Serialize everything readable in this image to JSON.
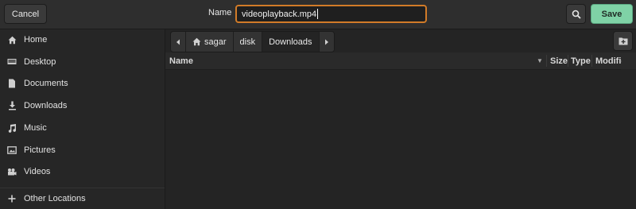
{
  "header": {
    "cancel_label": "Cancel",
    "name_label": "Name",
    "filename_value": "videoplayback.mp4",
    "save_label": "Save"
  },
  "sidebar": {
    "items": [
      {
        "label": "Home",
        "icon": "home-icon"
      },
      {
        "label": "Desktop",
        "icon": "desktop-icon"
      },
      {
        "label": "Documents",
        "icon": "document-icon"
      },
      {
        "label": "Downloads",
        "icon": "download-icon"
      },
      {
        "label": "Music",
        "icon": "music-icon"
      },
      {
        "label": "Pictures",
        "icon": "picture-icon"
      },
      {
        "label": "Videos",
        "icon": "video-icon"
      },
      {
        "label": "Other Locations",
        "icon": "plus-icon"
      }
    ]
  },
  "path": {
    "crumbs": [
      "sagar",
      "disk",
      "Downloads"
    ],
    "active": "Downloads"
  },
  "columns": {
    "name": "Name",
    "size": "Size",
    "type": "Type",
    "modified": "Modified"
  },
  "colors": {
    "accent_focus": "#d17b28",
    "save_bg": "#7fd2a6"
  }
}
